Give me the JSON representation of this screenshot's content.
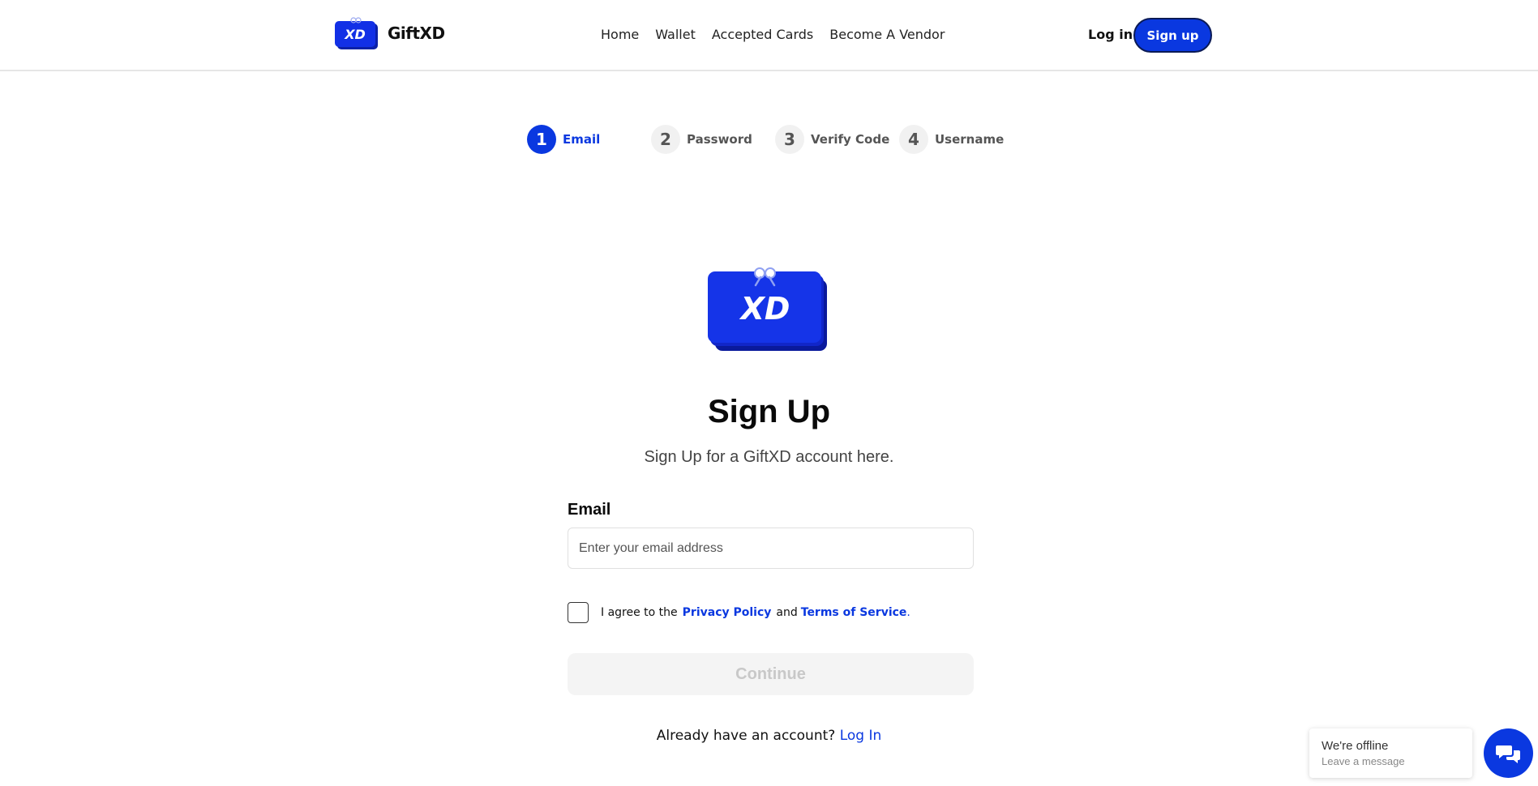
{
  "header": {
    "brand_name": "GiftXD",
    "logo_text": "XD",
    "nav": [
      {
        "label": "Home"
      },
      {
        "label": "Wallet"
      },
      {
        "label": "Accepted Cards"
      },
      {
        "label": "Become A Vendor"
      }
    ],
    "login_label": "Log in",
    "signup_label": "Sign up"
  },
  "stepper": {
    "steps": [
      {
        "number": "1",
        "label": "Email",
        "active": true
      },
      {
        "number": "2",
        "label": "Password",
        "active": false
      },
      {
        "number": "3",
        "label": "Verify Code",
        "active": false
      },
      {
        "number": "4",
        "label": "Username",
        "active": false
      }
    ]
  },
  "main": {
    "logo_text": "XD",
    "title": "Sign Up",
    "subtitle": "Sign Up for a GiftXD account here.",
    "email_label": "Email",
    "email_placeholder": "Enter your email address",
    "email_value": "",
    "agree_prefix": "I agree to the",
    "privacy_label": "Privacy Policy",
    "agree_and": "and",
    "terms_label": "Terms of Service",
    "agree_suffix": ".",
    "continue_label": "Continue",
    "have_account_text": "Already have an account?",
    "login_link_label": "Log In"
  },
  "chat": {
    "title": "We're offline",
    "subtitle": "Leave a message",
    "icon": "chat-bubbles-icon"
  },
  "colors": {
    "accent": "#0a38e0",
    "disabled_bg": "#f4f4f4",
    "disabled_text": "#c8c8c8"
  }
}
